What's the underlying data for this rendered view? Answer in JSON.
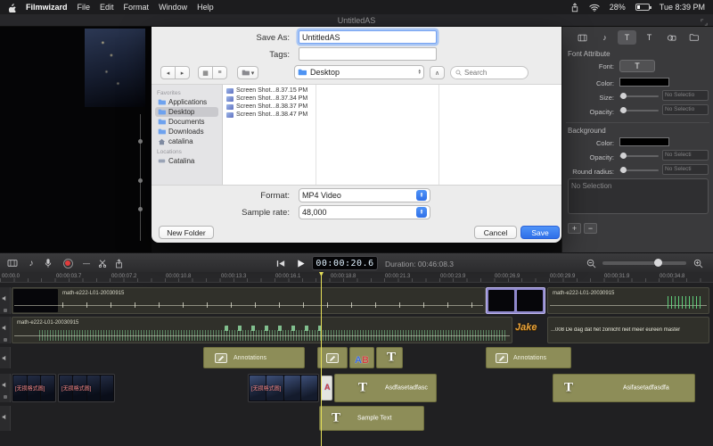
{
  "colors": {
    "accent_blue": "#3b82f7",
    "clip_olive": "#8d8d58",
    "clip_selected_purple": "#8f88cc",
    "playhead_yellow": "#e6e05a",
    "record_red": "#e03c3c",
    "jake_gold": "#e8a33d"
  },
  "icons": {
    "back_chevron": "◂",
    "forward_chevron": "▸",
    "grid_view": "▦",
    "list_view": "≡",
    "chevron_up": "▴",
    "chevron_down": "▾",
    "up_arrow": "∧",
    "music_note": "♪",
    "dash": "—",
    "t_glyph": "T"
  },
  "menubar": {
    "app_name": "Filmwizard",
    "menus": [
      "File",
      "Edit",
      "Format",
      "Window",
      "Help"
    ],
    "battery_percent": "28%",
    "clock": "Tue 8:39 PM"
  },
  "window": {
    "title": "UntitledAS"
  },
  "save_dialog": {
    "save_as_label": "Save As:",
    "save_as_value": "UntitledAS",
    "tags_label": "Tags:",
    "tags_value": "",
    "location_value": "Desktop",
    "search_placeholder": "Search",
    "sidebar": {
      "favorites_header": "Favorites",
      "items": [
        "Applications",
        "Desktop",
        "Documents",
        "Downloads",
        "catalina"
      ],
      "locations_header": "Locations",
      "location_items": [
        "Catalina"
      ]
    },
    "files": [
      "Screen Shot...8.37.15 PM",
      "Screen Shot...8.37.34 PM",
      "Screen Shot...8.38.37 PM",
      "Screen Shot...8.38.47 PM"
    ],
    "format_label": "Format:",
    "format_value": "MP4 Video",
    "sample_rate_label": "Sample rate:",
    "sample_rate_value": "48,000",
    "new_folder_button": "New Folder",
    "cancel_button": "Cancel",
    "save_button": "Save"
  },
  "inspector": {
    "font_header": "Font Attribute",
    "font_label": "Font:",
    "font_button_glyph": "T",
    "color_label": "Color:",
    "size_label": "Size:",
    "size_value": "No Selectio",
    "opacity_label": "Opacity:",
    "opacity_value": "No Selectio",
    "background_header": "Background",
    "bg_color_label": "Color:",
    "bg_opacity_label": "Opacity:",
    "bg_opacity_value": "No Selecti",
    "round_radius_label": "Round radius:",
    "round_radius_value": "No Selecti",
    "selection_text": "No Selection",
    "add_button": "+",
    "remove_button": "−"
  },
  "transport": {
    "timecode": "00:00:20.6",
    "duration_label": "Duration: 00:46:08.3"
  },
  "ruler": {
    "labels": [
      "00:00.0",
      "00:00:03.7",
      "00:00:07.2",
      "00:00:10.8",
      "00:00:13.3",
      "00:00:16.1",
      "00:00:18.8",
      "00:00:21.3",
      "00:00:23.9",
      "00:00:26.9",
      "00:00:29.9",
      "00:00:31.9",
      "00:00:34.8"
    ]
  },
  "timeline": {
    "track1_clip_label": "math-e222-L01-20030915",
    "track1_clip2_label": "math-e222-L01-20030915",
    "track2_clip_label": "math-e222-L01-20030915",
    "track2_caption": "...008 De dag dat het zonlicht niet meer eureen master",
    "jake_sticker": "Jake",
    "annotations_label_1": "Annotations",
    "annotations_label_2": "Annotations",
    "ab_sticker_a": "A",
    "ab_sticker_b": "B",
    "a_sticker": "A",
    "t_glyph": "T",
    "track4_tag": "[无损格式图]",
    "track4_text_label_1": "Asdfasetadfasc",
    "track4_text_label_2": "Asifasetadfasdfa",
    "track5_text_label": "Sample Text"
  }
}
